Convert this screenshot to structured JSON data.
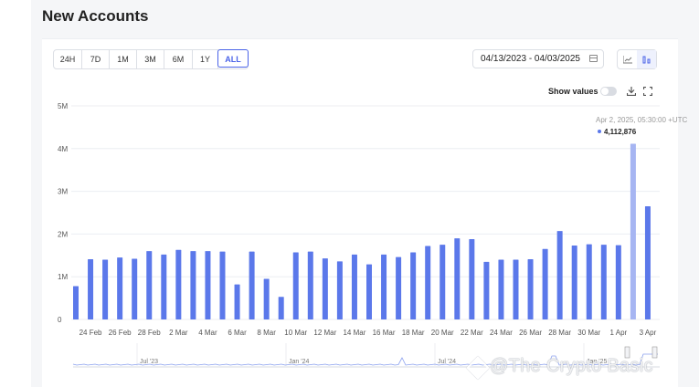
{
  "title": "New Accounts",
  "time_tabs": [
    "24H",
    "7D",
    "1M",
    "3M",
    "6M",
    "1Y",
    "ALL"
  ],
  "active_tab": "ALL",
  "date_range": "04/13/2023 - 04/03/2025",
  "show_values_label": "Show values",
  "tooltip": {
    "date": "Apr 2, 2025, 05:30:00 +UTC",
    "value": "4,112,876"
  },
  "navigator_labels": [
    "Jul '23",
    "Jan '24",
    "Jul '24",
    "Jan '25"
  ],
  "watermark": "@The Crypto Basic",
  "colors": {
    "bar": "#5b78ea",
    "bar_highlight": "#a6b5f2",
    "accent": "#4a63e8",
    "grid": "#eceef2"
  },
  "chart_data": {
    "type": "bar",
    "ylim": [
      0,
      5000000
    ],
    "yticks": [
      0,
      1000000,
      2000000,
      3000000,
      4000000,
      5000000
    ],
    "ytick_labels": [
      "0",
      "1M",
      "2M",
      "3M",
      "4M",
      "5M"
    ],
    "xtick_labels": [
      "24 Feb",
      "26 Feb",
      "28 Feb",
      "2 Mar",
      "4 Mar",
      "6 Mar",
      "8 Mar",
      "10 Mar",
      "12 Mar",
      "14 Mar",
      "16 Mar",
      "18 Mar",
      "20 Mar",
      "22 Mar",
      "24 Mar",
      "26 Mar",
      "28 Mar",
      "30 Mar",
      "1 Apr",
      "3 Apr"
    ],
    "categories": [
      "23 Feb",
      "24 Feb",
      "25 Feb",
      "26 Feb",
      "27 Feb",
      "28 Feb",
      "1 Mar",
      "2 Mar",
      "3 Mar",
      "4 Mar",
      "5 Mar",
      "6 Mar",
      "7 Mar",
      "8 Mar",
      "9 Mar",
      "10 Mar",
      "11 Mar",
      "12 Mar",
      "13 Mar",
      "14 Mar",
      "15 Mar",
      "16 Mar",
      "17 Mar",
      "18 Mar",
      "19 Mar",
      "20 Mar",
      "21 Mar",
      "22 Mar",
      "23 Mar",
      "24 Mar",
      "25 Mar",
      "26 Mar",
      "27 Mar",
      "28 Mar",
      "29 Mar",
      "30 Mar",
      "31 Mar",
      "1 Apr",
      "2 Apr",
      "3 Apr"
    ],
    "values": [
      780000,
      1410000,
      1400000,
      1450000,
      1420000,
      1600000,
      1520000,
      1630000,
      1600000,
      1600000,
      1590000,
      820000,
      1590000,
      950000,
      530000,
      1570000,
      1590000,
      1430000,
      1360000,
      1520000,
      1290000,
      1520000,
      1460000,
      1570000,
      1720000,
      1750000,
      1900000,
      1880000,
      1350000,
      1400000,
      1400000,
      1410000,
      1650000,
      2070000,
      1730000,
      1760000,
      1750000,
      1740000,
      4112876,
      2650000
    ],
    "highlight_index": 38
  }
}
